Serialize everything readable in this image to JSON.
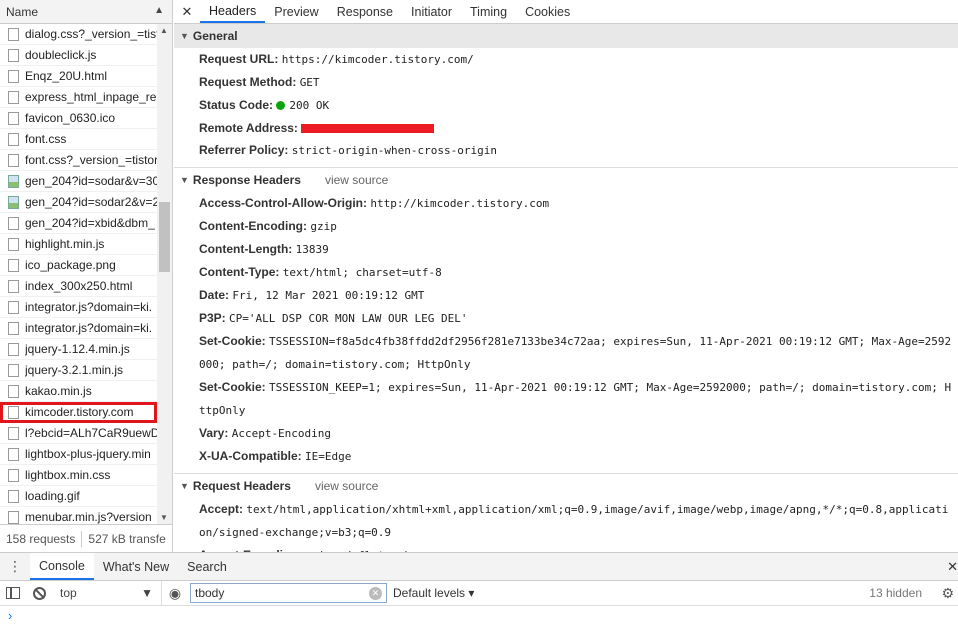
{
  "left": {
    "header": "Name",
    "sort_icon": "triangle-up",
    "items": [
      {
        "name": "dialog.css?_version_=tist",
        "icon": "file"
      },
      {
        "name": "doubleclick.js",
        "icon": "file"
      },
      {
        "name": "Enqz_20U.html",
        "icon": "file"
      },
      {
        "name": "express_html_inpage_ren",
        "icon": "file"
      },
      {
        "name": "favicon_0630.ico",
        "icon": "file"
      },
      {
        "name": "font.css",
        "icon": "file"
      },
      {
        "name": "font.css?_version_=tistor",
        "icon": "file"
      },
      {
        "name": "gen_204?id=sodar&v=30",
        "icon": "image"
      },
      {
        "name": "gen_204?id=sodar2&v=2",
        "icon": "image"
      },
      {
        "name": "gen_204?id=xbid&dbm_",
        "icon": "file"
      },
      {
        "name": "highlight.min.js",
        "icon": "file"
      },
      {
        "name": "ico_package.png",
        "icon": "file"
      },
      {
        "name": "index_300x250.html",
        "icon": "file"
      },
      {
        "name": "integrator.js?domain=ki.",
        "icon": "file"
      },
      {
        "name": "integrator.js?domain=ki.",
        "icon": "file"
      },
      {
        "name": "jquery-1.12.4.min.js",
        "icon": "file"
      },
      {
        "name": "jquery-3.2.1.min.js",
        "icon": "file"
      },
      {
        "name": "kakao.min.js",
        "icon": "file"
      },
      {
        "name": "kimcoder.tistory.com",
        "icon": "file",
        "selected": true
      },
      {
        "name": "l?ebcid=ALh7CaR9uewD",
        "icon": "file"
      },
      {
        "name": "lightbox-plus-jquery.min",
        "icon": "file"
      },
      {
        "name": "lightbox.min.css",
        "icon": "file"
      },
      {
        "name": "loading.gif",
        "icon": "file"
      },
      {
        "name": "menubar.min.js?version",
        "icon": "file"
      }
    ],
    "footer": {
      "requests": "158 requests",
      "transferred": "527 kB transfe"
    }
  },
  "tabs": [
    "Headers",
    "Preview",
    "Response",
    "Initiator",
    "Timing",
    "Cookies"
  ],
  "active_tab": "Headers",
  "general": {
    "title": "General",
    "url_label": "Request URL:",
    "url": "https://kimcoder.tistory.com/",
    "method_label": "Request Method:",
    "method": "GET",
    "status_label": "Status Code:",
    "status": "200 OK",
    "status_color": "#0ca40c",
    "remote_label": "Remote Address:",
    "remote_redaction_color": "#ed1c24",
    "referrer_label": "Referrer Policy:",
    "referrer": "strict-origin-when-cross-origin"
  },
  "response_headers": {
    "title": "Response Headers",
    "view_source": "view source",
    "rows": [
      {
        "k": "Access-Control-Allow-Origin:",
        "v": "http://kimcoder.tistory.com"
      },
      {
        "k": "Content-Encoding:",
        "v": "gzip"
      },
      {
        "k": "Content-Length:",
        "v": "13839"
      },
      {
        "k": "Content-Type:",
        "v": "text/html; charset=utf-8"
      },
      {
        "k": "Date:",
        "v": "Fri, 12 Mar 2021 00:19:12 GMT"
      },
      {
        "k": "P3P:",
        "v": "CP='ALL DSP COR MON LAW OUR LEG DEL'"
      },
      {
        "k": "Set-Cookie:",
        "v": "TSSESSION=f8a5dc4fb38ffdd2df2956f281e7133be34c72aa; expires=Sun, 11-Apr-2021 00:19:12 GMT; Max-Age=2592000; path=/; domain=tistory.com; HttpOnly"
      },
      {
        "k": "Set-Cookie:",
        "v": "TSSESSION_KEEP=1; expires=Sun, 11-Apr-2021 00:19:12 GMT; Max-Age=2592000; path=/; domain=tistory.com; HttpOnly"
      },
      {
        "k": "Vary:",
        "v": "Accept-Encoding"
      },
      {
        "k": "X-UA-Compatible:",
        "v": "IE=Edge"
      }
    ]
  },
  "request_headers": {
    "title": "Request Headers",
    "view_source": "view source",
    "rows": [
      {
        "k": "Accept:",
        "v": "text/html,application/xhtml+xml,application/xml;q=0.9,image/avif,image/webp,image/apng,*/*;q=0.8,application/signed-exchange;v=b3;q=0.9"
      },
      {
        "k": "Accept-Encoding:",
        "v": "gzip, deflate, br"
      }
    ]
  },
  "drawer": {
    "tabs": [
      "Console",
      "What's New",
      "Search"
    ],
    "active": "Console",
    "context": "top",
    "filter_value": "tbody",
    "levels": "Default levels ▾",
    "hidden": "13 hidden",
    "prompt": "›"
  }
}
